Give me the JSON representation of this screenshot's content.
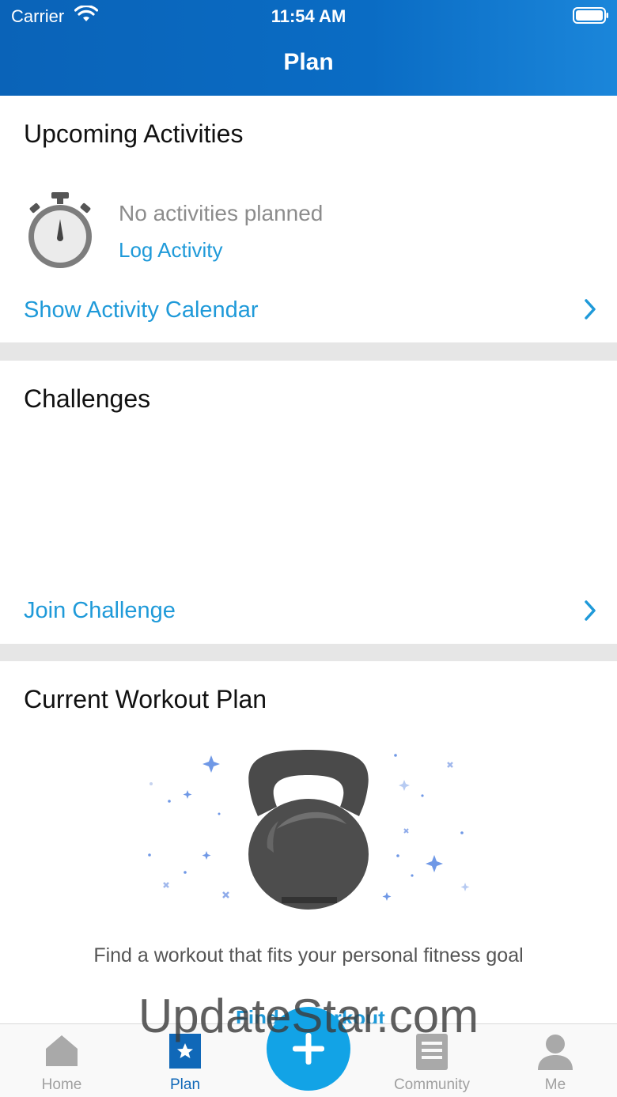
{
  "status_bar": {
    "carrier": "Carrier",
    "time": "11:54 AM"
  },
  "header": {
    "title": "Plan"
  },
  "upcoming": {
    "title": "Upcoming Activities",
    "empty_text": "No activities planned",
    "log_link": "Log Activity",
    "calendar_link": "Show Activity Calendar"
  },
  "challenges": {
    "title": "Challenges",
    "join_link": "Join Challenge"
  },
  "workout": {
    "title": "Current Workout Plan",
    "description": "Find a workout that fits your personal fitness goal",
    "find_link": "Find a Workout"
  },
  "watermark": "UpdateStar.com",
  "tabs": [
    {
      "label": "Home",
      "icon": "home-icon",
      "active": false
    },
    {
      "label": "Plan",
      "icon": "plan-icon",
      "active": true
    },
    {
      "label": "",
      "icon": "plus-icon",
      "active": false
    },
    {
      "label": "Community",
      "icon": "community-icon",
      "active": false
    },
    {
      "label": "Me",
      "icon": "profile-icon",
      "active": false
    }
  ],
  "colors": {
    "header": "#0a63b8",
    "link": "#1f9ad9",
    "fab": "#12a3e6",
    "tab_active": "#1068b8"
  }
}
